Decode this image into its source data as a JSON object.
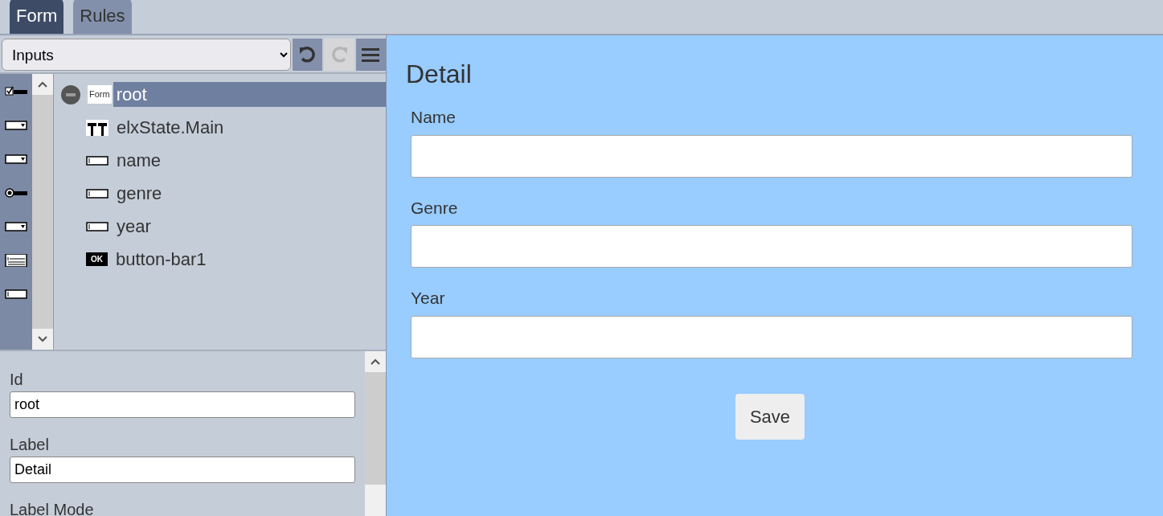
{
  "tabs": [
    {
      "label": "Form",
      "selected": true
    },
    {
      "label": "Rules",
      "selected": false
    }
  ],
  "toolbar": {
    "category": "Inputs",
    "buttons": [
      {
        "kind": "undo",
        "disabled": false
      },
      {
        "kind": "redo",
        "disabled": true
      },
      {
        "kind": "menu",
        "disabled": false
      }
    ]
  },
  "palette": [
    {
      "kind": "checkbox"
    },
    {
      "kind": "select"
    },
    {
      "kind": "select"
    },
    {
      "kind": "radio"
    },
    {
      "kind": "select"
    },
    {
      "kind": "textarea"
    },
    {
      "kind": "textbox"
    }
  ],
  "tree": [
    {
      "label": "root",
      "kind": "form",
      "tag": "Form",
      "selected": true,
      "children": [
        {
          "label": "elxState.Main",
          "kind": "state",
          "selected": false
        },
        {
          "label": "name",
          "kind": "textbox",
          "selected": false
        },
        {
          "label": "genre",
          "kind": "textbox",
          "selected": false
        },
        {
          "label": "year",
          "kind": "textbox",
          "selected": false
        },
        {
          "label": "button-bar1",
          "kind": "button",
          "tag": "OK",
          "selected": false
        }
      ]
    }
  ],
  "properties": [
    {
      "label": "Id",
      "value": "root"
    },
    {
      "label": "Label",
      "value": "Detail"
    },
    {
      "label": "Label Mode"
    }
  ],
  "preview": {
    "title": "Detail",
    "fields": [
      {
        "label": "Name"
      },
      {
        "label": "Genre"
      },
      {
        "label": "Year"
      }
    ],
    "button": "Save"
  }
}
